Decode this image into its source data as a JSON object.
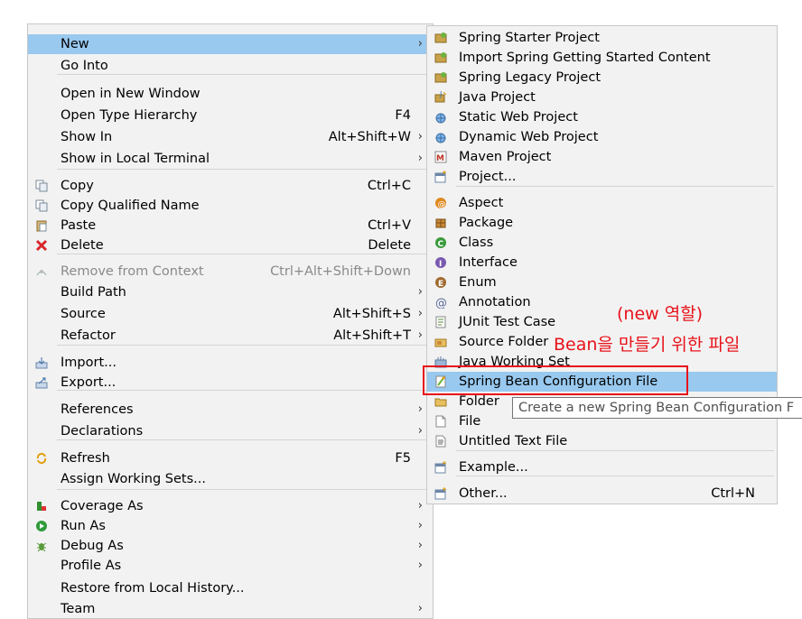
{
  "left_menu": {
    "items": [
      {
        "name": "menu-item-new",
        "label": "New",
        "accel": "",
        "arrow": "›",
        "icon": "",
        "highlighted": true
      },
      {
        "name": "menu-item-go-into",
        "label": "Go Into",
        "accel": "",
        "arrow": "",
        "icon": ""
      },
      {
        "name": "menu-item-open-in-new-window",
        "label": "Open in New Window",
        "accel": "",
        "arrow": "",
        "icon": ""
      },
      {
        "name": "menu-item-open-type-hierarchy",
        "label": "Open Type Hierarchy",
        "accel": "F4",
        "arrow": "",
        "icon": ""
      },
      {
        "name": "menu-item-show-in",
        "label": "Show In",
        "accel": "Alt+Shift+W",
        "arrow": "›",
        "icon": ""
      },
      {
        "name": "menu-item-show-in-local-terminal",
        "label": "Show in Local Terminal",
        "accel": "",
        "arrow": "›",
        "icon": ""
      },
      {
        "name": "menu-item-copy",
        "label": "Copy",
        "accel": "Ctrl+C",
        "arrow": "",
        "icon": "copy-icon"
      },
      {
        "name": "menu-item-copy-qualified-name",
        "label": "Copy Qualified Name",
        "accel": "",
        "arrow": "",
        "icon": "copy-icon"
      },
      {
        "name": "menu-item-paste",
        "label": "Paste",
        "accel": "Ctrl+V",
        "arrow": "",
        "icon": "paste-icon"
      },
      {
        "name": "menu-item-delete",
        "label": "Delete",
        "accel": "Delete",
        "arrow": "",
        "icon": "delete-icon"
      },
      {
        "name": "menu-item-remove-from-context",
        "label": "Remove from Context",
        "accel": "Ctrl+Alt+Shift+Down",
        "arrow": "",
        "icon": "remove-context-icon",
        "disabled": true
      },
      {
        "name": "menu-item-build-path",
        "label": "Build Path",
        "accel": "",
        "arrow": "›",
        "icon": ""
      },
      {
        "name": "menu-item-source",
        "label": "Source",
        "accel": "Alt+Shift+S",
        "arrow": "›",
        "icon": ""
      },
      {
        "name": "menu-item-refactor",
        "label": "Refactor",
        "accel": "Alt+Shift+T",
        "arrow": "›",
        "icon": ""
      },
      {
        "name": "menu-item-import",
        "label": "Import...",
        "accel": "",
        "arrow": "",
        "icon": "import-icon"
      },
      {
        "name": "menu-item-export",
        "label": "Export...",
        "accel": "",
        "arrow": "",
        "icon": "export-icon"
      },
      {
        "name": "menu-item-references",
        "label": "References",
        "accel": "",
        "arrow": "›",
        "icon": ""
      },
      {
        "name": "menu-item-declarations",
        "label": "Declarations",
        "accel": "",
        "arrow": "›",
        "icon": ""
      },
      {
        "name": "menu-item-refresh",
        "label": "Refresh",
        "accel": "F5",
        "arrow": "",
        "icon": "refresh-icon"
      },
      {
        "name": "menu-item-assign-working-sets",
        "label": "Assign Working Sets...",
        "accel": "",
        "arrow": "",
        "icon": ""
      },
      {
        "name": "menu-item-coverage-as",
        "label": "Coverage As",
        "accel": "",
        "arrow": "›",
        "icon": "coverage-icon"
      },
      {
        "name": "menu-item-run-as",
        "label": "Run As",
        "accel": "",
        "arrow": "›",
        "icon": "run-icon"
      },
      {
        "name": "menu-item-debug-as",
        "label": "Debug As",
        "accel": "",
        "arrow": "›",
        "icon": "debug-icon"
      },
      {
        "name": "menu-item-profile-as",
        "label": "Profile As",
        "accel": "",
        "arrow": "›",
        "icon": ""
      },
      {
        "name": "menu-item-restore-from-local-history",
        "label": "Restore from Local History...",
        "accel": "",
        "arrow": "",
        "icon": ""
      },
      {
        "name": "menu-item-team",
        "label": "Team",
        "accel": "",
        "arrow": "›",
        "icon": ""
      }
    ]
  },
  "right_menu": {
    "items": [
      {
        "name": "submenu-item-spring-starter-project",
        "label": "Spring Starter Project",
        "accel": "",
        "icon": "spring-project-icon"
      },
      {
        "name": "submenu-item-import-spring-getting-started",
        "label": "Import Spring Getting Started Content",
        "accel": "",
        "icon": "spring-project-icon"
      },
      {
        "name": "submenu-item-spring-legacy-project",
        "label": "Spring Legacy Project",
        "accel": "",
        "icon": "spring-project-icon"
      },
      {
        "name": "submenu-item-java-project",
        "label": "Java Project",
        "accel": "",
        "icon": "java-project-icon"
      },
      {
        "name": "submenu-item-static-web-project",
        "label": "Static Web Project",
        "accel": "",
        "icon": "web-project-icon"
      },
      {
        "name": "submenu-item-dynamic-web-project",
        "label": "Dynamic Web Project",
        "accel": "",
        "icon": "web-project-icon"
      },
      {
        "name": "submenu-item-maven-project",
        "label": "Maven Project",
        "accel": "",
        "icon": "maven-icon"
      },
      {
        "name": "submenu-item-project",
        "label": "Project...",
        "accel": "",
        "icon": "new-project-icon"
      },
      {
        "name": "submenu-item-aspect",
        "label": "Aspect",
        "accel": "",
        "icon": "aspect-icon"
      },
      {
        "name": "submenu-item-package",
        "label": "Package",
        "accel": "",
        "icon": "package-icon"
      },
      {
        "name": "submenu-item-class",
        "label": "Class",
        "accel": "",
        "icon": "class-icon"
      },
      {
        "name": "submenu-item-interface",
        "label": "Interface",
        "accel": "",
        "icon": "interface-icon"
      },
      {
        "name": "submenu-item-enum",
        "label": "Enum",
        "accel": "",
        "icon": "enum-icon"
      },
      {
        "name": "submenu-item-annotation",
        "label": "Annotation",
        "accel": "",
        "icon": "annotation-icon"
      },
      {
        "name": "submenu-item-junit-test-case",
        "label": "JUnit Test Case",
        "accel": "",
        "icon": "junit-icon"
      },
      {
        "name": "submenu-item-source-folder",
        "label": "Source Folder",
        "accel": "",
        "icon": "source-folder-icon"
      },
      {
        "name": "submenu-item-java-working-set",
        "label": "Java Working Set",
        "accel": "",
        "icon": "working-set-icon"
      },
      {
        "name": "submenu-item-spring-bean-configuration-file",
        "label": "Spring Bean Configuration File",
        "accel": "",
        "icon": "spring-bean-file-icon",
        "highlighted": true
      },
      {
        "name": "submenu-item-folder",
        "label": "Folder",
        "accel": "",
        "icon": "folder-icon"
      },
      {
        "name": "submenu-item-file",
        "label": "File",
        "accel": "",
        "icon": "file-icon"
      },
      {
        "name": "submenu-item-untitled-text-file",
        "label": "Untitled Text File",
        "accel": "",
        "icon": "text-file-icon"
      },
      {
        "name": "submenu-item-example",
        "label": "Example...",
        "accel": "",
        "icon": "new-project-icon"
      },
      {
        "name": "submenu-item-other",
        "label": "Other...",
        "accel": "Ctrl+N",
        "icon": "new-project-icon"
      }
    ]
  },
  "tooltip": {
    "text": "Create a new Spring Bean Configuration F"
  },
  "annotation": {
    "line1": "(new 역할)",
    "line2": "Bean을 만들기 위한 파일",
    "color": "#e8121a"
  }
}
